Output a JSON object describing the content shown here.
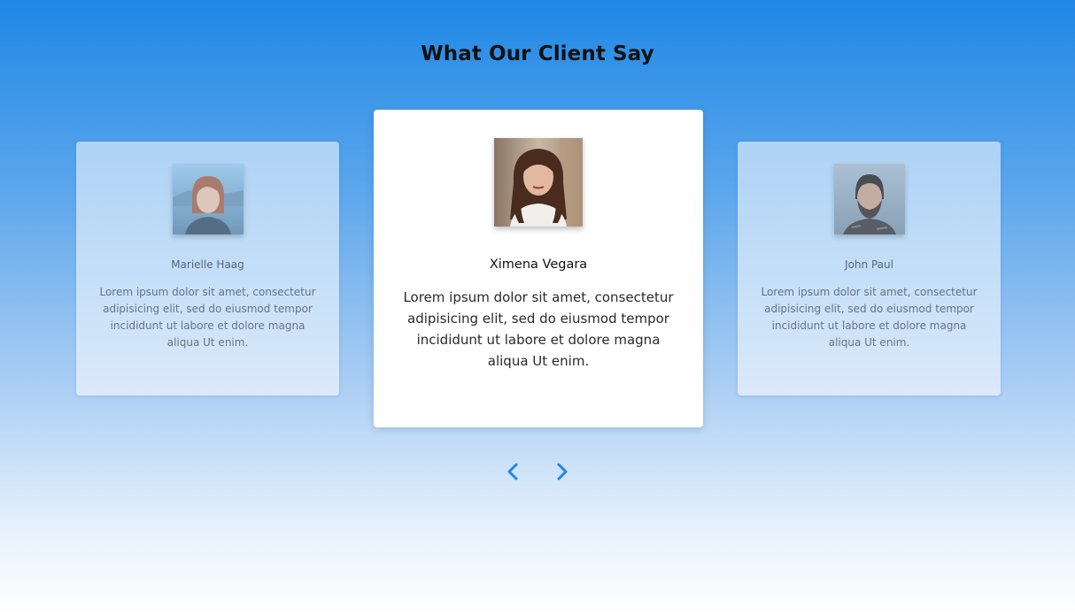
{
  "section": {
    "title": "What Our Client Say"
  },
  "testimonials": [
    {
      "name": "Marielle Haag",
      "text": "Lorem ipsum dolor sit amet, consectetur adipisicing elit, sed do eiusmod tempor incididunt ut labore et dolore magna aliqua Ut enim.",
      "state": "inactive"
    },
    {
      "name": "Ximena Vegara",
      "text": "Lorem ipsum dolor sit amet, consectetur adipisicing elit, sed do eiusmod tempor incididunt ut labore et dolore magna aliqua Ut enim.",
      "state": "active"
    },
    {
      "name": "John Paul",
      "text": "Lorem ipsum dolor sit amet, consectetur adipisicing elit, sed do eiusmod tempor incididunt ut labore et dolore magna aliqua Ut enim.",
      "state": "inactive"
    }
  ],
  "navigation": {
    "prev_icon": "chevron-left-icon",
    "next_icon": "chevron-right-icon"
  },
  "colors": {
    "accent": "#1f88e5",
    "heading": "#111111"
  }
}
